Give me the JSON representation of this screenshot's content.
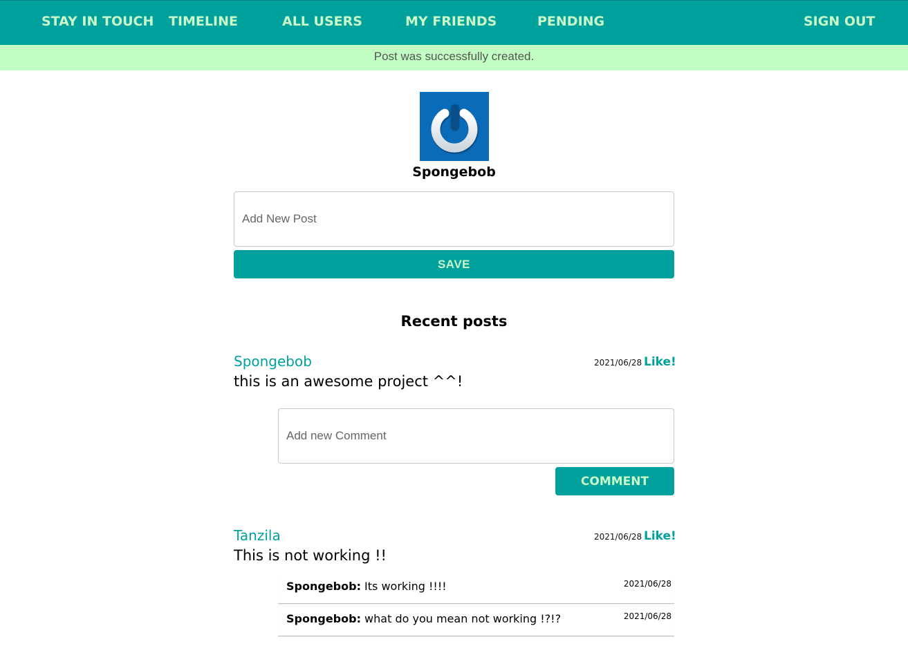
{
  "nav": {
    "brand": "STAY IN TOUCH",
    "timeline": "TIMELINE",
    "all_users": "ALL USERS",
    "my_friends": "MY FRIENDS",
    "pending": "PENDING",
    "sign_out": "SIGN OUT"
  },
  "notice": "Post was successfully created.",
  "profile": {
    "avatar_icon": "power-icon",
    "name": "Spongebob"
  },
  "new_post": {
    "placeholder": "Add New Post",
    "save_label": "SAVE"
  },
  "recent_title": "Recent posts",
  "posts": [
    {
      "author": "Spongebob",
      "date": "2021/06/28",
      "like_label": "Like!",
      "content": "this is an awesome project ^^!",
      "comment_placeholder": "Add new Comment",
      "comment_button": "COMMENT",
      "comments": []
    },
    {
      "author": "Tanzila",
      "date": "2021/06/28",
      "like_label": "Like!",
      "content": "This is not working !!",
      "comments": [
        {
          "author": "Spongebob:",
          "text": " Its working !!!!",
          "date": "2021/06/28"
        },
        {
          "author": "Spongebob:",
          "text": " what do you mean not working !?!?",
          "date": "2021/06/28"
        }
      ]
    }
  ],
  "colors": {
    "primary": "#00a19c",
    "nav_text": "#c9f9c9",
    "notice_bg": "#c2fdc3",
    "avatar_bg": "#0a6bb8"
  }
}
